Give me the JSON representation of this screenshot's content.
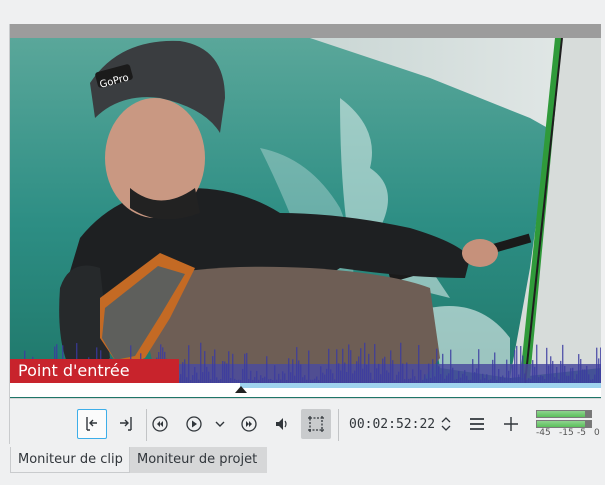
{
  "monitor": {
    "inpoint_label": "Point d'entrée",
    "timecode": "00:02:52:22"
  },
  "toolbar": {
    "buttons": [
      {
        "name": "set-zone-in-button",
        "icon": "zone-in-icon"
      },
      {
        "name": "set-zone-out-button",
        "icon": "zone-out-icon"
      },
      {
        "name": "rewind-button",
        "icon": "rewind-icon"
      },
      {
        "name": "play-button",
        "icon": "play-icon"
      },
      {
        "name": "play-options-button",
        "icon": "chevron-down-icon"
      },
      {
        "name": "forward-button",
        "icon": "fast-forward-icon"
      },
      {
        "name": "volume-button",
        "icon": "speaker-icon"
      },
      {
        "name": "overlay-button",
        "icon": "crop-frame-icon"
      },
      {
        "name": "menu-button",
        "icon": "hamburger-icon"
      },
      {
        "name": "add-button",
        "icon": "plus-icon"
      }
    ]
  },
  "audio_meter": {
    "scale": [
      "-45",
      "-15",
      "-5",
      "0"
    ],
    "level_left": 0.9,
    "level_right": 0.9
  },
  "tabs": [
    {
      "label": "Moniteur de clip",
      "active": false
    },
    {
      "label": "Moniteur de projet",
      "active": true
    }
  ],
  "colors": {
    "accent": "#3daee9",
    "inpoint": "#c8232c",
    "zone": "#9fd3ee",
    "waveform": "#3b3ba0"
  }
}
